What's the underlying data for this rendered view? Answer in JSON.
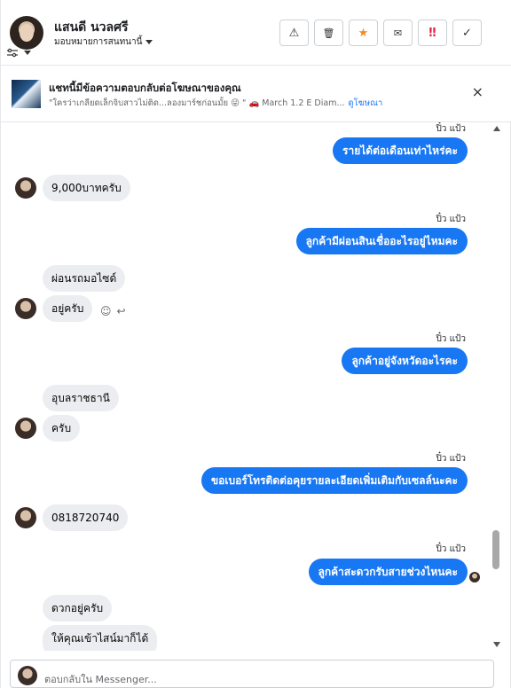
{
  "header": {
    "contact_name": "แสนดี นวลศรี",
    "assign_label": "มอบหมายการสนทนานี้",
    "actions": [
      {
        "icon": "warning-icon",
        "glyph": "⚠"
      },
      {
        "icon": "trash-icon",
        "glyph": "🗑"
      },
      {
        "icon": "star-icon",
        "glyph": "★",
        "color": "#f28c28"
      },
      {
        "icon": "envelope-open-icon",
        "glyph": "✉"
      },
      {
        "icon": "priority-icon",
        "glyph": "‼",
        "color": "#e41e3f"
      },
      {
        "icon": "check-icon",
        "glyph": "✓"
      }
    ]
  },
  "notification": {
    "title": "แชทนี้มีข้อความตอบกลับต่อโฆษณาของคุณ",
    "snippet": "\"ใครว่าเกลียดเล็กจิบสาวไม่ติด...ลองมาร์ชก่อนมั้ย 😜 \" 🚗 March 1.2 E Diam...",
    "link": "ดูโฆษณา",
    "close": "×"
  },
  "messages": [
    {
      "time": "ปิ๋ว แป้ว",
      "out": "รายได้ต่อเดือนเท่าไหร่คะ"
    },
    {
      "in": "9,000บาทครับ"
    },
    {
      "time": "ปิ๋ว แป้ว",
      "out": "ลูกค้ามีผ่อนสินเชื่ออะไรอยู่ไหมคะ"
    },
    {
      "in1": "ผ่อนรถมอไซด์",
      "in2": "อยู่ครับ"
    },
    {
      "time": "ปิ๋ว แป้ว",
      "out": "ลูกค้าอยู่จังหวัดอะไรคะ"
    },
    {
      "in1": "อุบลราชธานี",
      "in2": "ครับ"
    },
    {
      "time": "ปิ๋ว แป้ว",
      "out": "ขอเบอร์โทรติดต่อคุยรายละเอียดเพิ่มเติมกับเซลล์นะคะ"
    },
    {
      "in": "0818720740"
    },
    {
      "time": "ปิ๋ว แป้ว",
      "out": "ลูกค้าสะดวกรับสายช่วงไหนคะ"
    },
    {
      "in1": "ดวกอยู่ครับ",
      "in2": "ให้คุณเข้าไสน์มาก็ได้"
    }
  ],
  "composer": {
    "placeholder": "ตอบกลับใน Messenger..."
  }
}
